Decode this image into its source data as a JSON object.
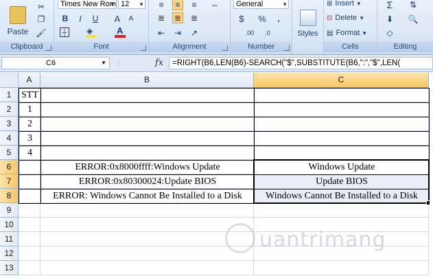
{
  "ribbon": {
    "clipboard": {
      "paste_label": "Paste",
      "group_label": "Clipboard"
    },
    "font": {
      "font_name": "Times New Roman",
      "font_size": "12",
      "bold": "B",
      "italic": "I",
      "underline": "U",
      "grow_icon": "A",
      "shrink_icon": "A",
      "group_label": "Font",
      "font_color": "#e02020",
      "fill_color": "#f2e04a"
    },
    "alignment": {
      "group_label": "Alignment"
    },
    "number": {
      "format": "General",
      "currency": "$",
      "percent": "%",
      "comma": ",",
      "inc_decimal": ".00",
      "dec_decimal": ".0",
      "group_label": "Number"
    },
    "styles": {
      "label": "Styles"
    },
    "cells": {
      "insert": "Insert",
      "delete": "Delete",
      "format": "Format",
      "group_label": "Cells"
    },
    "editing": {
      "sum_icon": "Σ",
      "group_label": "Editing"
    }
  },
  "formula_bar": {
    "name_box": "C6",
    "fx": "fx",
    "formula": "=RIGHT(B6,LEN(B6)-SEARCH(\"$\",SUBSTITUTE(B6,\":\",\"$\",LEN("
  },
  "sheet": {
    "columns": [
      "A",
      "B",
      "C"
    ],
    "rows": [
      "1",
      "2",
      "3",
      "4",
      "5",
      "6",
      "7",
      "8",
      "9",
      "10",
      "11",
      "12",
      "13"
    ],
    "cells": {
      "A1": "STT",
      "A2": "1",
      "A3": "2",
      "A4": "3",
      "A5": "4",
      "B6": "ERROR:0x8000ffff:Windows Update",
      "B7": "ERROR:0x80300024:Update BIOS",
      "B8": "ERROR: Windows Cannot Be Installed to a Disk",
      "C6": "Windows Update",
      "C7": "Update BIOS",
      "C8": "Windows Cannot Be Installed to a Disk"
    }
  },
  "watermark": "uantrimang"
}
